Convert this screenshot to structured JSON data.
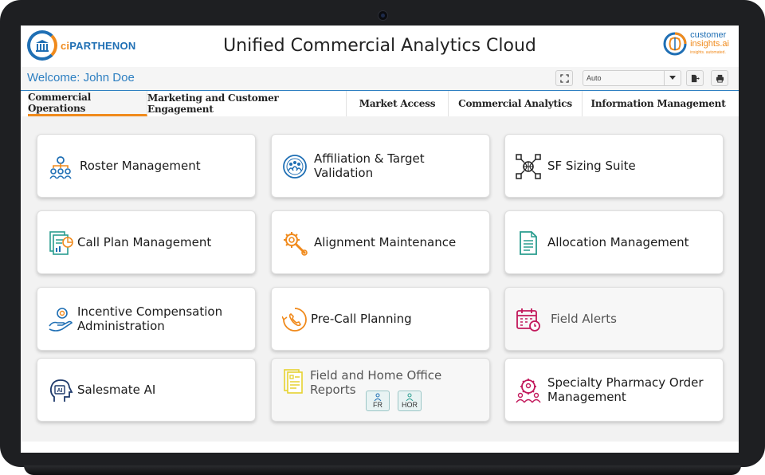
{
  "app": {
    "title": "Unified Commercial Analytics Cloud",
    "brand_left_ci": "ci",
    "brand_left_name": "PARTHENON",
    "brand_right_line1": "customer",
    "brand_right_line2": "insights.ai",
    "brand_right_line3": "insights. automated."
  },
  "welcome": {
    "text": "Welcome: John Doe"
  },
  "toolbar": {
    "select_value": "Auto"
  },
  "tabs": [
    {
      "label": "Commercial Operations",
      "active": true
    },
    {
      "label": "Marketing and Customer Engagement",
      "active": false
    },
    {
      "label": "Market Access",
      "active": false
    },
    {
      "label": "Commercial Analytics",
      "active": false
    },
    {
      "label": "Information Management",
      "active": false
    }
  ],
  "tiles": [
    {
      "label": "Roster Management",
      "icon": "team-hierarchy-icon",
      "color": "#1f6fb4"
    },
    {
      "label": "Affiliation & Target Validation",
      "icon": "group-circle-icon",
      "color": "#1f6fb4"
    },
    {
      "label": "SF Sizing Suite",
      "icon": "network-globe-icon",
      "color": "#222222"
    },
    {
      "label": "Call Plan Management",
      "icon": "report-chart-icon",
      "color": "#2a9d8f"
    },
    {
      "label": "Alignment Maintenance",
      "icon": "wrench-gear-icon",
      "color": "#f08a1c"
    },
    {
      "label": "Allocation Management",
      "icon": "document-icon",
      "color": "#2a9d8f"
    },
    {
      "label": "Incentive Compensation Administration",
      "icon": "hand-coin-icon",
      "color": "#1f6fb4"
    },
    {
      "label": "Pre-Call Planning",
      "icon": "phone-cycle-icon",
      "color": "#f08a1c"
    },
    {
      "label": "Field Alerts",
      "icon": "calendar-clock-icon",
      "color": "#c2185b"
    },
    {
      "label": "Salesmate AI",
      "icon": "ai-head-icon",
      "color": "#1f3a6b"
    },
    {
      "label": "Field and Home Office Reports",
      "icon": "report-list-icon",
      "color": "#e6d230"
    },
    {
      "label": "Specialty Pharmacy Order Management",
      "icon": "gear-people-icon",
      "color": "#c2185b"
    }
  ],
  "report_buttons": [
    {
      "label": "FR"
    },
    {
      "label": "HOR"
    }
  ]
}
